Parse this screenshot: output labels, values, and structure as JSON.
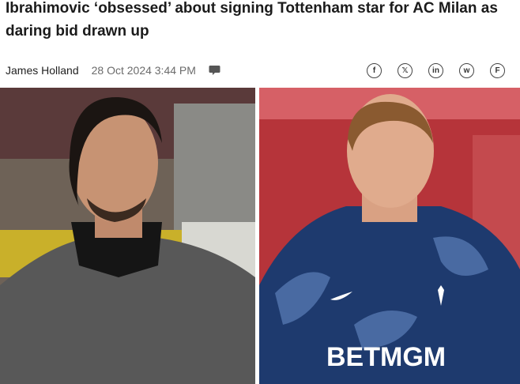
{
  "article": {
    "headline": "Ibrahimovic ‘obsessed’ about signing Tottenham star for AC Milan as daring bid drawn up",
    "author": "James Holland",
    "timestamp": "28 Oct 2024 3:44 PM"
  },
  "share": {
    "facebook": "f",
    "x": "𝕏",
    "linkedin": "in",
    "whatsapp": "w",
    "flipboard": "F"
  },
  "photos": {
    "left": {
      "icon": "person-photo-ibrahimovic"
    },
    "right": {
      "icon": "person-photo-tottenham-player",
      "shirt_sponsor": "BETMGM"
    }
  },
  "colors": {
    "accent": "#1b1b1b",
    "shirt": "#1e3a6e"
  }
}
